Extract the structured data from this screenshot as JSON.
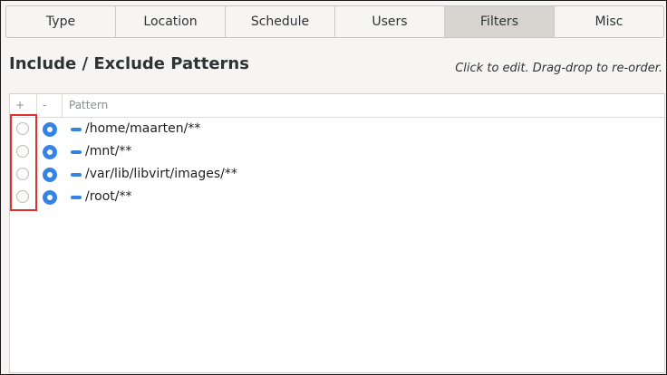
{
  "tabs": [
    {
      "label": "Type",
      "active": false
    },
    {
      "label": "Location",
      "active": false
    },
    {
      "label": "Schedule",
      "active": false
    },
    {
      "label": "Users",
      "active": false
    },
    {
      "label": "Filters",
      "active": true
    },
    {
      "label": "Misc",
      "active": false
    }
  ],
  "section": {
    "title": "Include / Exclude Patterns",
    "hint": "Click to edit. Drag-drop to re-order."
  },
  "list": {
    "headers": {
      "include": "+",
      "exclude": "-",
      "pattern": "Pattern"
    },
    "rows": [
      {
        "pattern": "/home/maarten/**",
        "include_selected": false,
        "exclude_selected": true
      },
      {
        "pattern": "/mnt/**",
        "include_selected": false,
        "exclude_selected": true
      },
      {
        "pattern": "/var/lib/libvirt/images/**",
        "include_selected": false,
        "exclude_selected": true
      },
      {
        "pattern": "/root/**",
        "include_selected": false,
        "exclude_selected": true
      }
    ]
  },
  "colors": {
    "accent": "#3584e4",
    "annotation": "#e03131",
    "active_tab": "#d8d4d0"
  }
}
